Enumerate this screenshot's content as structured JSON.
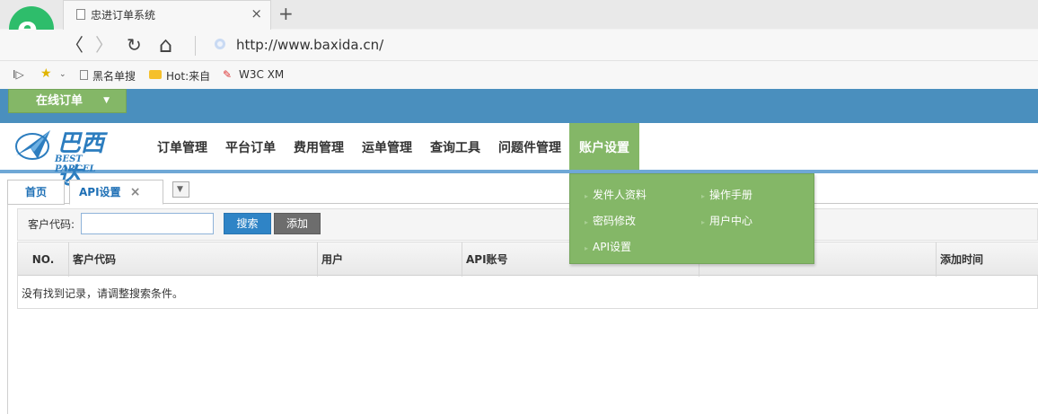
{
  "browser": {
    "tab_title": "忠进订单系统",
    "tab_close": "×",
    "new_tab": "+",
    "url": "http://www.baxida.cn/",
    "nav_back": "〈",
    "nav_forward": "〉",
    "nav_refresh": "↻",
    "nav_home": "⌂",
    "bookmarks": {
      "toggle": "I▷",
      "items": [
        "黑名单搜",
        "Hot:来自",
        "W3C XM"
      ]
    },
    "logo_letter": "e"
  },
  "app": {
    "online_order_label": "在线订单",
    "brand_name": "巴西达",
    "brand_sub": "BEST PARCEL",
    "menu": [
      "订单管理",
      "平台订单",
      "费用管理",
      "运单管理",
      "查询工具",
      "问题件管理",
      "账户设置"
    ],
    "account_dropdown": {
      "left": [
        "发件人资料",
        "密码修改",
        "API设置"
      ],
      "right": [
        "操作手册",
        "用户中心"
      ]
    },
    "tabs": {
      "home": "首页",
      "api": "API设置",
      "close": "×"
    },
    "search": {
      "label": "客户代码:",
      "input_value": "",
      "search_button": "搜索",
      "add_button": "添加"
    },
    "table": {
      "columns": [
        "NO.",
        "客户代码",
        "用户",
        "API账号",
        "",
        "添加时间"
      ],
      "empty_message": "没有找到记录，请调整搜索条件。"
    }
  },
  "colors": {
    "topbar": "#4a8fbe",
    "accent_green": "#84b767",
    "brand_blue": "#2c7dbf"
  }
}
